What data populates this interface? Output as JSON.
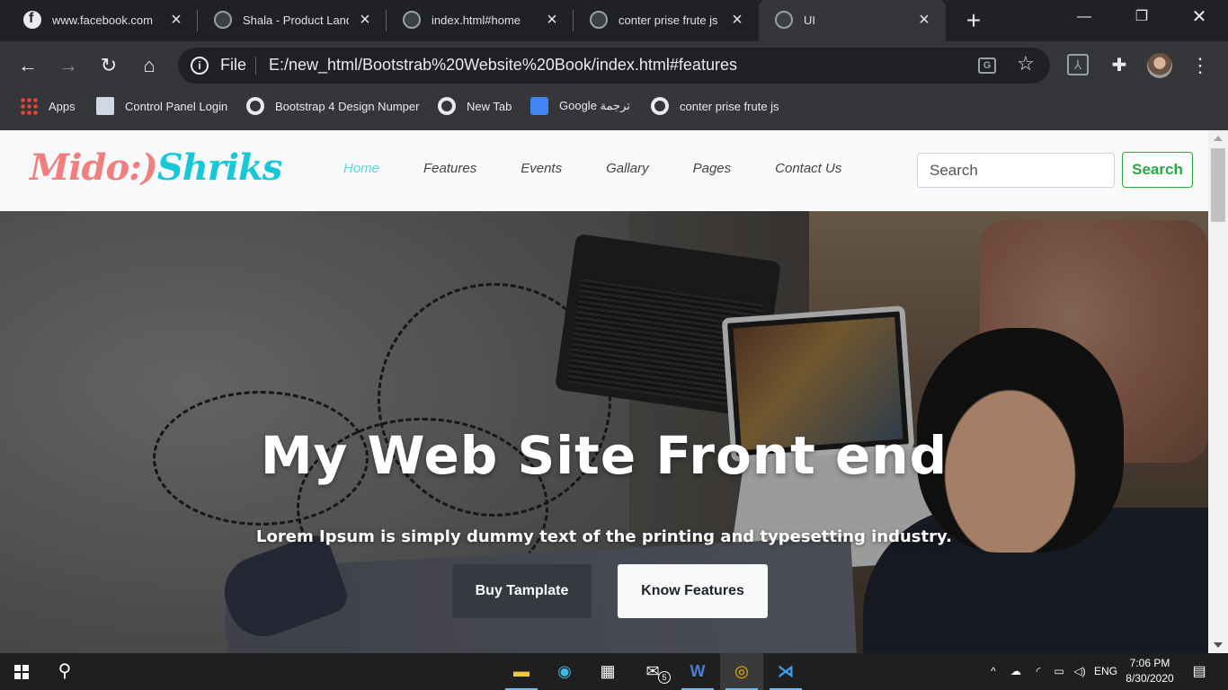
{
  "browser": {
    "tabs": [
      {
        "title": "www.facebook.com",
        "icon": "facebook-icon"
      },
      {
        "title": "Shala - Product Landi",
        "icon": "globe-icon"
      },
      {
        "title": "index.html#home",
        "icon": "globe-icon"
      },
      {
        "title": "conter prise frute js",
        "icon": "globe-icon"
      },
      {
        "title": "UI",
        "icon": "globe-icon",
        "active": true
      }
    ],
    "address": {
      "scheme_label": "File",
      "url": "E:/new_html/Bootstrab%20Website%20Book/index.html#features"
    },
    "bookmarks": [
      {
        "label": "Apps",
        "icon": "apps-grid-icon"
      },
      {
        "label": "Control Panel Login",
        "icon": "control-panel-icon"
      },
      {
        "label": "Bootstrap 4 Design Numper",
        "icon": "globe-icon"
      },
      {
        "label": "New Tab",
        "icon": "globe-icon"
      },
      {
        "label": "Google ترجمة",
        "icon": "google-translate-icon"
      },
      {
        "label": "conter prise frute js",
        "icon": "globe-icon"
      }
    ]
  },
  "site": {
    "brand": {
      "part1": "Mido:)",
      "part2": "Shriks",
      "color1": "#f08080",
      "color2": "#17c8d8"
    },
    "nav": [
      {
        "label": "Home",
        "active": true
      },
      {
        "label": "Features"
      },
      {
        "label": "Events"
      },
      {
        "label": "Gallary"
      },
      {
        "label": "Pages"
      },
      {
        "label": "Contact Us"
      }
    ],
    "search": {
      "placeholder": "Search",
      "button_label": "Search",
      "button_color": "#28a745"
    },
    "hero": {
      "title": "My Web Site Front end",
      "subtitle": "Lorem Ipsum is simply dummy text of the printing and typesetting industry.",
      "primary_button": "Buy Tamplate",
      "secondary_button": "Know Features"
    }
  },
  "taskbar": {
    "pinned": [
      "file-explorer-icon",
      "edge-icon",
      "store-icon",
      "mail-icon",
      "word-icon",
      "chrome-icon",
      "vscode-icon"
    ],
    "mail_badge": "5",
    "language": "ENG",
    "time": "7:06 PM",
    "date": "8/30/2020"
  }
}
